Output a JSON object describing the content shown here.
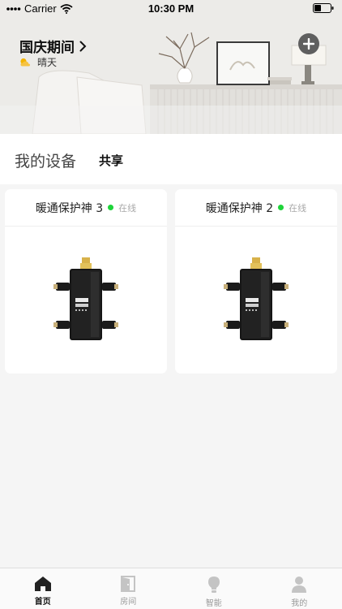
{
  "status_bar": {
    "carrier": "Carrier",
    "time": "10:30 PM"
  },
  "header": {
    "location": "国庆期间",
    "weather": "晴天",
    "weather_icon": "sun-cloud-icon",
    "add_icon": "plus-icon"
  },
  "tabs": {
    "my_devices": "我的设备",
    "share": "共享"
  },
  "devices": [
    {
      "name": "暖通保护神 3",
      "status": "在线",
      "status_color": "#1ed43a"
    },
    {
      "name": "暖通保护神 2",
      "status": "在线",
      "status_color": "#1ed43a"
    }
  ],
  "nav": [
    {
      "label": "首页",
      "icon": "home-icon",
      "active": true
    },
    {
      "label": "房间",
      "icon": "door-icon",
      "active": false
    },
    {
      "label": "智能",
      "icon": "lightbulb-icon",
      "active": false
    },
    {
      "label": "我的",
      "icon": "user-icon",
      "active": false
    }
  ]
}
